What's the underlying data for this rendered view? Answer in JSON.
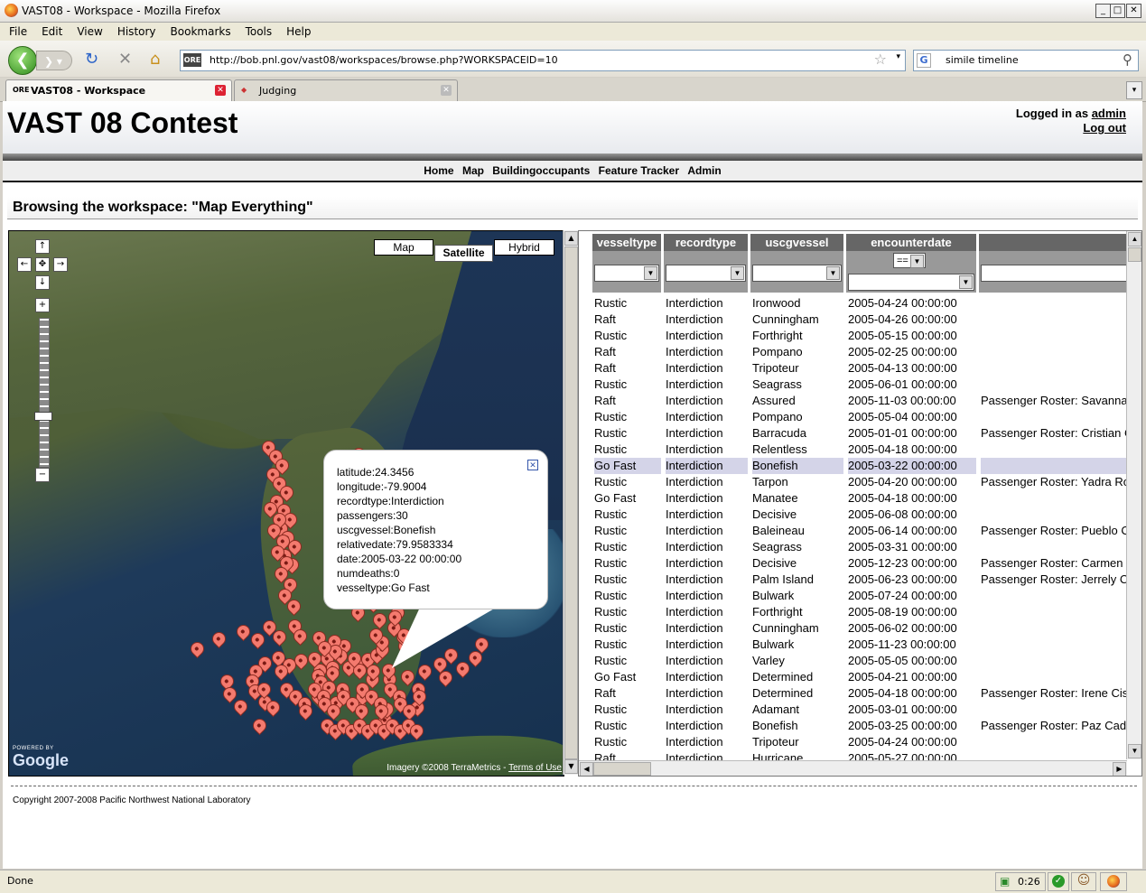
{
  "window": {
    "title": "VAST08 - Workspace - Mozilla Firefox"
  },
  "menu": [
    "File",
    "Edit",
    "View",
    "History",
    "Bookmarks",
    "Tools",
    "Help"
  ],
  "nav": {
    "url": "http://bob.pnl.gov/vast08/workspaces/browse.php?WORKSPACEID=10",
    "search_value": "simile timeline"
  },
  "tabs": [
    {
      "label": "VAST08 - Workspace",
      "active": true
    },
    {
      "label": "Judging",
      "active": false
    }
  ],
  "page": {
    "title": "VAST 08 Contest",
    "logged_in_prefix": "Logged in as",
    "user": "admin",
    "logout": "Log out",
    "nav": [
      "Home",
      "Map",
      "Buildingoccupants",
      "Feature Tracker",
      "Admin"
    ],
    "workspace_heading": "Browsing the workspace: \"Map Everything\"",
    "copyright": "Copyright 2007-2008 Pacific Northwest National Laboratory"
  },
  "map": {
    "types": [
      "Map",
      "Satellite",
      "Hybrid"
    ],
    "selected_type": "Satellite",
    "attribution": "Imagery ©2008 TerraMetrics -",
    "terms": "Terms of Use",
    "powered": "POWERED BY",
    "brand": "Google",
    "popup": [
      "latitude:24.3456",
      "longitude:-79.9004",
      "recordtype:Interdiction",
      "passengers:30",
      "uscgvessel:Bonefish",
      "relativedate:79.9583334",
      "date:2005-03-22 00:00:00",
      "numdeaths:0",
      "vesseltype:Go Fast"
    ]
  },
  "table": {
    "columns": [
      "vesseltype",
      "recordtype",
      "uscgvessel",
      "encounterdate",
      ""
    ],
    "operator": "==",
    "highlighted_row": 10,
    "rows": [
      [
        "Rustic",
        "Interdiction",
        "Ironwood",
        "2005-04-24 00:00:00",
        ""
      ],
      [
        "Raft",
        "Interdiction",
        "Cunningham",
        "2005-04-26 00:00:00",
        ""
      ],
      [
        "Rustic",
        "Interdiction",
        "Forthright",
        "2005-05-15 00:00:00",
        ""
      ],
      [
        "Raft",
        "Interdiction",
        "Pompano",
        "2005-02-25 00:00:00",
        ""
      ],
      [
        "Raft",
        "Interdiction",
        "Tripoteur",
        "2005-04-13 00:00:00",
        ""
      ],
      [
        "Rustic",
        "Interdiction",
        "Seagrass",
        "2005-06-01 00:00:00",
        ""
      ],
      [
        "Raft",
        "Interdiction",
        "Assured",
        "2005-11-03 00:00:00",
        "Passenger Roster: Savanna"
      ],
      [
        "Rustic",
        "Interdiction",
        "Pompano",
        "2005-05-04 00:00:00",
        ""
      ],
      [
        "Rustic",
        "Interdiction",
        "Barracuda",
        "2005-01-01 00:00:00",
        "Passenger Roster: Cristian C"
      ],
      [
        "Rustic",
        "Interdiction",
        "Relentless",
        "2005-04-18 00:00:00",
        ""
      ],
      [
        "Go Fast",
        "Interdiction",
        "Bonefish",
        "2005-03-22 00:00:00",
        ""
      ],
      [
        "Rustic",
        "Interdiction",
        "Tarpon",
        "2005-04-20 00:00:00",
        "Passenger Roster: Yadra Ro"
      ],
      [
        "Go Fast",
        "Interdiction",
        "Manatee",
        "2005-04-18 00:00:00",
        ""
      ],
      [
        "Rustic",
        "Interdiction",
        "Decisive",
        "2005-06-08 00:00:00",
        ""
      ],
      [
        "Rustic",
        "Interdiction",
        "Baleineau",
        "2005-06-14 00:00:00",
        "Passenger Roster: Pueblo C"
      ],
      [
        "Rustic",
        "Interdiction",
        "Seagrass",
        "2005-03-31 00:00:00",
        ""
      ],
      [
        "Rustic",
        "Interdiction",
        "Decisive",
        "2005-12-23 00:00:00",
        "Passenger Roster: Carmen T"
      ],
      [
        "Rustic",
        "Interdiction",
        "Palm Island",
        "2005-06-23 00:00:00",
        "Passenger Roster: Jerrely C"
      ],
      [
        "Rustic",
        "Interdiction",
        "Bulwark",
        "2005-07-24 00:00:00",
        ""
      ],
      [
        "Rustic",
        "Interdiction",
        "Forthright",
        "2005-08-19 00:00:00",
        ""
      ],
      [
        "Rustic",
        "Interdiction",
        "Cunningham",
        "2005-06-02 00:00:00",
        ""
      ],
      [
        "Rustic",
        "Interdiction",
        "Bulwark",
        "2005-11-23 00:00:00",
        ""
      ],
      [
        "Rustic",
        "Interdiction",
        "Varley",
        "2005-05-05 00:00:00",
        ""
      ],
      [
        "Go Fast",
        "Interdiction",
        "Determined",
        "2005-04-21 00:00:00",
        ""
      ],
      [
        "Raft",
        "Interdiction",
        "Determined",
        "2005-04-18 00:00:00",
        "Passenger Roster: Irene Cis"
      ],
      [
        "Rustic",
        "Interdiction",
        "Adamant",
        "2005-03-01 00:00:00",
        ""
      ],
      [
        "Rustic",
        "Interdiction",
        "Bonefish",
        "2005-03-25 00:00:00",
        "Passenger Roster: Paz Cade"
      ],
      [
        "Rustic",
        "Interdiction",
        "Tripoteur",
        "2005-04-24 00:00:00",
        ""
      ],
      [
        "Raft",
        "Interdiction",
        "Hurricane",
        "2005-05-27 00:00:00",
        ""
      ]
    ]
  },
  "status": {
    "text": "Done",
    "timer": "0:26"
  }
}
